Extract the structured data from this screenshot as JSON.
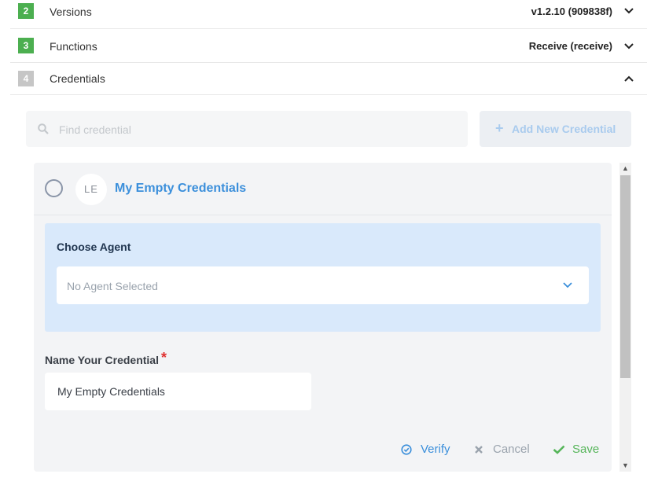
{
  "steps": [
    {
      "number": "2",
      "label": "Versions",
      "value": "v1.2.10 (909838f)",
      "color": "#4caf50",
      "expanded": false
    },
    {
      "number": "3",
      "label": "Functions",
      "value": "Receive (receive)",
      "color": "#4caf50",
      "expanded": false
    },
    {
      "number": "4",
      "label": "Credentials",
      "value": "",
      "color": "#c6c6c6",
      "expanded": true
    }
  ],
  "search": {
    "placeholder": "Find credential"
  },
  "add_button": {
    "label": "Add New Credential"
  },
  "credential": {
    "avatar_initials": "LE",
    "title": "My Empty Credentials",
    "choose_agent_label": "Choose Agent",
    "agent_placeholder": "No Agent Selected",
    "name_label": "Name Your Credential",
    "required_mark": "*",
    "name_value": "My Empty Credentials"
  },
  "actions": {
    "verify": "Verify",
    "cancel": "Cancel",
    "save": "Save"
  },
  "colors": {
    "accent": "#3b8fdb",
    "success": "#55b559",
    "muted": "#9aa3ad",
    "required": "#e03131"
  }
}
